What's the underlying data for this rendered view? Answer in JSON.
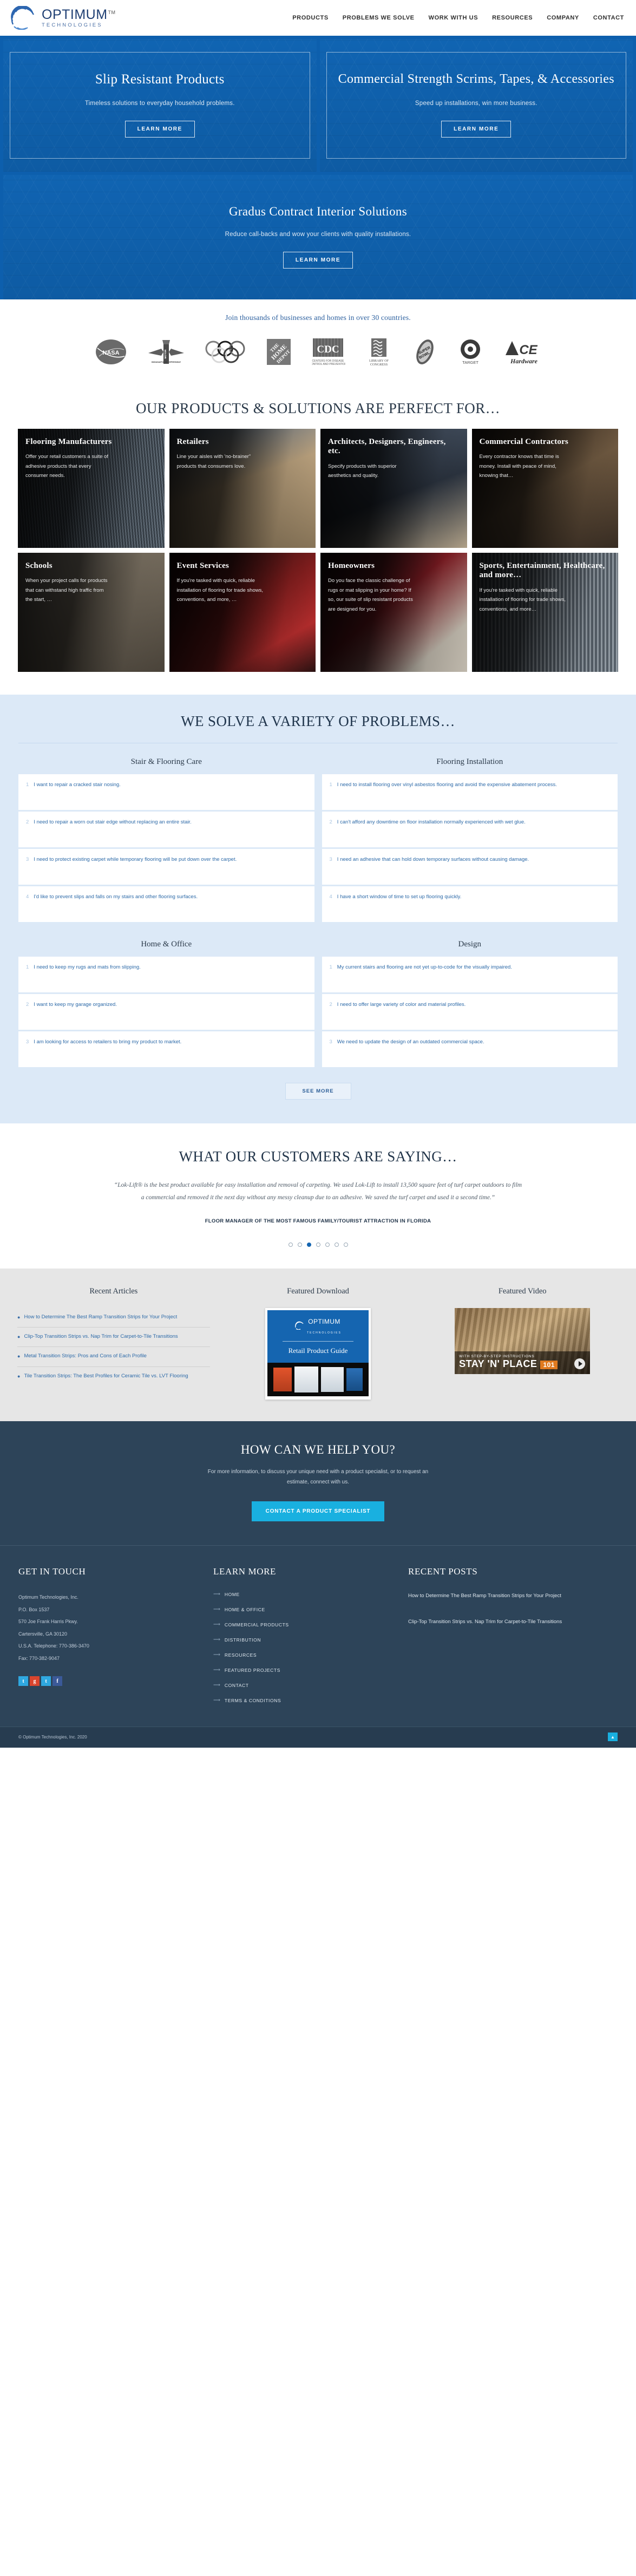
{
  "brand": {
    "name": "OPTIMUM",
    "sub": "TECHNOLOGIES",
    "tm": "TM"
  },
  "nav": {
    "items": [
      {
        "label": "PRODUCTS"
      },
      {
        "label": "PROBLEMS WE SOLVE"
      },
      {
        "label": "WORK WITH US"
      },
      {
        "label": "RESOURCES"
      },
      {
        "label": "COMPANY"
      },
      {
        "label": "CONTACT"
      }
    ]
  },
  "hero": {
    "panels": [
      {
        "title": "Slip Resistant Products",
        "subtitle": "Timeless solutions to everyday household problems.",
        "cta": "LEARN MORE"
      },
      {
        "title": "Commercial Strength Scrims, Tapes, & Accessories",
        "subtitle": "Speed up installations, win more business.",
        "cta": "LEARN MORE"
      },
      {
        "title": "Gradus Contract Interior Solutions",
        "subtitle": "Reduce call-backs and wow your clients with quality installations.",
        "cta": "LEARN MORE"
      }
    ]
  },
  "trust": {
    "headline": "Join thousands of businesses and homes in over 30 countries.",
    "logos": [
      {
        "name": "NASA",
        "label": "NASA"
      },
      {
        "name": "Indianapolis Motor Speedway",
        "label": "INDIANAPOLIS MOTOR SPEEDWAY"
      },
      {
        "name": "Olympic Rings",
        "label": "OLYMPICS"
      },
      {
        "name": "The Home Depot",
        "label": "THE HOME DEPOT"
      },
      {
        "name": "CDC",
        "label": "CDC"
      },
      {
        "name": "Library of Congress",
        "label": "LIBRARY OF CONGRESS"
      },
      {
        "name": "Super Bowl",
        "label": "SUPER BOWL"
      },
      {
        "name": "Target",
        "label": "TARGET"
      },
      {
        "name": "Ace Hardware",
        "label": "ACE Hardware"
      }
    ]
  },
  "solutions": {
    "title": "OUR PRODUCTS & SOLUTIONS ARE PERFECT FOR…",
    "cards": [
      {
        "title": "Flooring Manufacturers",
        "text": "Offer your retail customers a suite of adhesive products that every consumer needs.",
        "photo": "ph-floor"
      },
      {
        "title": "Retailers",
        "text": "Line your aisles with 'no-brainer\" products that consumers love.",
        "photo": "ph-retail"
      },
      {
        "title": "Architects, Designers, Engineers, etc.",
        "text": "Specify products with superior aesthetics and quality.",
        "photo": "ph-arch"
      },
      {
        "title": "Commercial Contractors",
        "text": "Every contractor knows that time is money. Install with peace of mind, knowing that…",
        "photo": "ph-contract"
      },
      {
        "title": "Schools",
        "text": "When your project calls for products that can withstand high traffic from the start, …",
        "photo": "ph-school"
      },
      {
        "title": "Event Services",
        "text": "If you're tasked with quick, reliable installation of flooring for trade shows, conventions, and more, …",
        "photo": "ph-event"
      },
      {
        "title": "Homeowners",
        "text": "Do you face the classic challenge of rugs or mat slipping in your home? If so, our suite of slip resistant products are designed for you.",
        "photo": "ph-home"
      },
      {
        "title": "Sports, Entertainment, Healthcare, and more…",
        "text": "If you're tasked with quick, reliable installation of flooring for trade shows, conventions, and more…",
        "photo": "ph-sports"
      }
    ]
  },
  "problems": {
    "title": "WE SOLVE A VARIETY OF PROBLEMS…",
    "see_more": "SEE MORE",
    "columns": [
      {
        "heading": "Stair & Flooring Care",
        "items": [
          {
            "num": "1",
            "text": "I want to repair a cracked stair nosing."
          },
          {
            "num": "2",
            "text": "I need to repair a worn out stair edge without replacing an entire stair."
          },
          {
            "num": "3",
            "text": "I need to protect existing carpet while temporary flooring will be put down over the carpet."
          },
          {
            "num": "4",
            "text": "I'd like to prevent slips and falls on my stairs and other flooring surfaces."
          }
        ]
      },
      {
        "heading": "Flooring Installation",
        "items": [
          {
            "num": "1",
            "text": "I need to install flooring over vinyl asbestos flooring and avoid the expensive abatement process."
          },
          {
            "num": "2",
            "text": "I can't afford any downtime on floor installation normally experienced with wet glue."
          },
          {
            "num": "3",
            "text": "I need an adhesive that can hold down temporary surfaces without causing damage."
          },
          {
            "num": "4",
            "text": "I have a short window of time to set up flooring quickly."
          }
        ]
      },
      {
        "heading": "Home & Office",
        "items": [
          {
            "num": "1",
            "text": "I need to keep my rugs and mats from slipping."
          },
          {
            "num": "2",
            "text": "I want to keep my garage organized."
          },
          {
            "num": "3",
            "text": "I am looking for access to retailers to bring my product to market."
          }
        ]
      },
      {
        "heading": "Design",
        "items": [
          {
            "num": "1",
            "text": "My current stairs and flooring are not yet up-to-code for the visually impaired."
          },
          {
            "num": "2",
            "text": "I need to offer large variety of color and material profiles."
          },
          {
            "num": "3",
            "text": "We need to update the design of an outdated commercial space."
          }
        ]
      }
    ]
  },
  "testimonial": {
    "title": "WHAT OUR CUSTOMERS ARE SAYING…",
    "quote": "“Lok-Lift® is the best product available for easy installation and removal of carpeting. We used Lok-Lift to install 13,500 square feet of turf carpet outdoors to film a commercial and removed it the next day without any messy cleanup due to an adhesive. We saved the turf carpet and used it a second time.”",
    "attribution": "FLOOR MANAGER OF THE MOST FAMOUS FAMILY/TOURIST ATTRACTION IN FLORIDA",
    "dot_count": 7,
    "active_dot": 3
  },
  "resources": {
    "articles": {
      "heading": "Recent Articles",
      "items": [
        {
          "title": "How to Determine The Best Ramp Transition Strips for Your Project"
        },
        {
          "title": "Clip-Top Transition Strips vs. Nap Trim for Carpet-to-Tile Transitions"
        },
        {
          "title": "Metal Transition Strips: Pros and Cons of Each Profile"
        },
        {
          "title": "Tile Transition Strips: The Best Profiles for Ceramic Tile vs. LVT Flooring"
        }
      ]
    },
    "download": {
      "heading": "Featured Download",
      "card_logo": "OPTIMUM",
      "card_logo_sub": "TECHNOLOGIES",
      "card_title": "Retail Product Guide"
    },
    "video": {
      "heading": "Featured Video",
      "kicker": "WITH STEP-BY-STEP INSTRUCTIONS",
      "title": "STAY 'N' PLACE",
      "badge": "101"
    }
  },
  "cta": {
    "title": "HOW CAN WE HELP YOU?",
    "text": "For more information, to discuss your unique need with a product specialist, or to request an estimate, connect with us.",
    "button": "CONTACT A PRODUCT SPECIALIST"
  },
  "footer": {
    "contact": {
      "heading": "GET IN TOUCH",
      "lines": [
        "Optimum Technologies, Inc.",
        "P.O. Box 1537",
        "570 Joe Frank Harris Pkwy.",
        "Cartersville, GA 30120",
        "U.S.A. Telephone: 770-386-3470",
        "Fax: 770-382-9047"
      ],
      "socials": [
        {
          "name": "twitter",
          "glyph": "t"
        },
        {
          "name": "google-plus",
          "glyph": "g"
        },
        {
          "name": "twitter",
          "glyph": "t"
        },
        {
          "name": "facebook",
          "glyph": "f"
        }
      ]
    },
    "learn": {
      "heading": "LEARN MORE",
      "items": [
        {
          "label": "HOME"
        },
        {
          "label": "HOME & OFFICE"
        },
        {
          "label": "COMMERCIAL PRODUCTS"
        },
        {
          "label": "DISTRIBUTION"
        },
        {
          "label": "RESOURCES"
        },
        {
          "label": "FEATURED PROJECTS"
        },
        {
          "label": "CONTACT"
        },
        {
          "label": "TERMS & CONDITIONS"
        }
      ]
    },
    "posts": {
      "heading": "RECENT POSTS",
      "items": [
        {
          "title": "How to Determine The Best Ramp Transition Strips for Your Project"
        },
        {
          "title": "Clip-Top Transition Strips vs. Nap Trim for Carpet-to-Tile Transitions"
        }
      ]
    },
    "copyright": "© Optimum Technologies, Inc. 2020",
    "to_top": "▲"
  }
}
